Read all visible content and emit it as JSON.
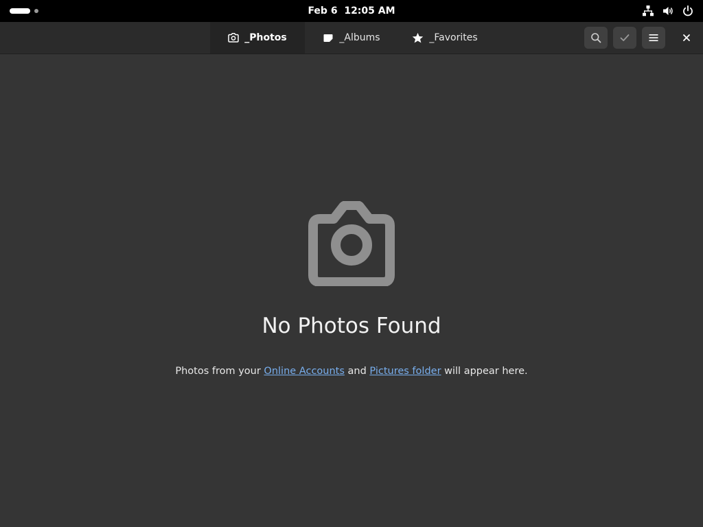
{
  "system_bar": {
    "clock_date": "Feb 6",
    "clock_time": "12:05 AM",
    "tray_icons": [
      "network-icon",
      "volume-icon",
      "power-icon"
    ]
  },
  "header": {
    "tabs": [
      {
        "label": "_Photos",
        "icon": "camera-icon",
        "active": true
      },
      {
        "label": "_Albums",
        "icon": "album-icon",
        "active": false
      },
      {
        "label": "_Favorites",
        "icon": "star-icon",
        "active": false
      }
    ],
    "buttons": [
      "search-icon",
      "checkmark-icon",
      "hamburger-menu-icon",
      "close-icon"
    ]
  },
  "empty_state": {
    "icon": "camera-icon",
    "title": "No Photos Found",
    "desc_prefix": "Photos from your ",
    "link_online_accounts": "Online Accounts",
    "desc_middle": " and ",
    "link_pictures_folder": "Pictures folder",
    "desc_suffix": " will appear here."
  },
  "colors": {
    "background": "#353535",
    "header_background": "#2b2b2b",
    "active_tab": "#242424",
    "link": "#78aeed",
    "icon_gray": "#8f8f8f"
  }
}
